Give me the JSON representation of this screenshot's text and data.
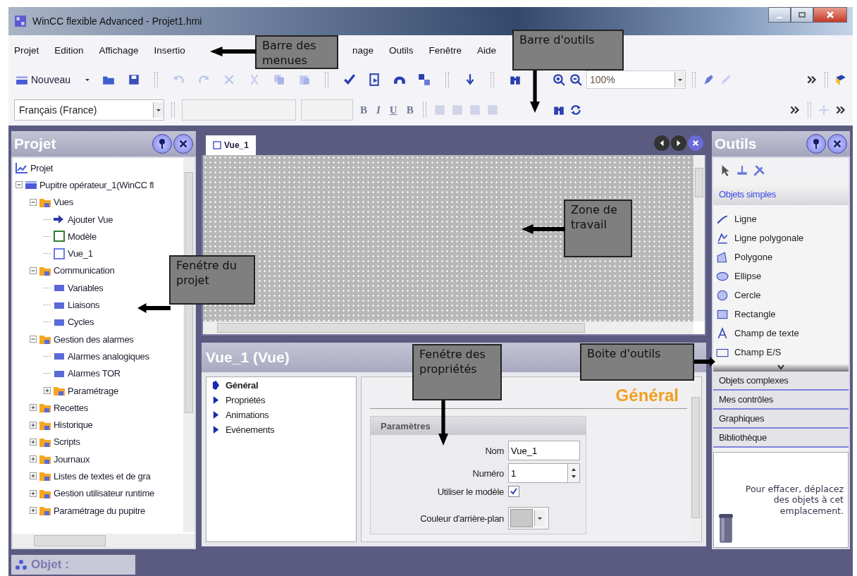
{
  "window": {
    "title": "WinCC flexible Advanced - Projet1.hmi"
  },
  "menu": [
    "Projet",
    "Edition",
    "Affichage",
    "Insertio",
    "nage",
    "Outils",
    "Fenêtre",
    "Aide"
  ],
  "toolbar": {
    "new_label": "Nouveau",
    "zoom": "100%",
    "language": "Français (France)",
    "format_buttons": [
      "B",
      "I",
      "U",
      "B"
    ]
  },
  "project_panel": {
    "title": "Projet",
    "root": "Projet",
    "tree": [
      {
        "label": "Pupitre opérateur_1(WinCC fl",
        "kind": "device",
        "expanded": true,
        "children": [
          {
            "label": "Vues",
            "kind": "folder",
            "expanded": true,
            "children": [
              {
                "label": "Ajouter Vue",
                "kind": "add"
              },
              {
                "label": "Modèle",
                "kind": "template"
              },
              {
                "label": "Vue_1",
                "kind": "screen"
              }
            ]
          },
          {
            "label": "Communication",
            "kind": "folder",
            "expanded": true,
            "children": [
              {
                "label": "Variables",
                "kind": "item"
              },
              {
                "label": "Liaisons",
                "kind": "item"
              },
              {
                "label": "Cycles",
                "kind": "item"
              }
            ]
          },
          {
            "label": "Gestion des alarmes",
            "kind": "folder",
            "expanded": true,
            "children": [
              {
                "label": "Alarmes analogiques",
                "kind": "item"
              },
              {
                "label": "Alarmes TOR",
                "kind": "item"
              },
              {
                "label": "Paramétrage",
                "kind": "folder",
                "expanded": false
              }
            ]
          },
          {
            "label": "Recettes",
            "kind": "folder",
            "expanded": false
          },
          {
            "label": "Historique",
            "kind": "folder",
            "expanded": false
          },
          {
            "label": "Scripts",
            "kind": "folder",
            "expanded": false
          },
          {
            "label": "Journaux",
            "kind": "folder",
            "expanded": false
          },
          {
            "label": "Listes de textes et de gra",
            "kind": "folder",
            "expanded": false
          },
          {
            "label": "Gestion utilisateur runtime",
            "kind": "folder",
            "expanded": false
          },
          {
            "label": "Paramétrage du pupitre",
            "kind": "folder",
            "expanded": false
          }
        ]
      }
    ]
  },
  "editor": {
    "tabs": [
      {
        "label": "Vue_1",
        "selected": true
      }
    ]
  },
  "properties": {
    "title": "Vue_1 (Vue)",
    "heading": "Général",
    "nav": [
      {
        "label": "Général",
        "selected": true
      },
      {
        "label": "Propriétés",
        "selected": false
      },
      {
        "label": "Animations",
        "selected": false
      },
      {
        "label": "Evénements",
        "selected": false
      }
    ],
    "group": "Paramètres",
    "name_label": "Nom",
    "name_value": "Vue_1",
    "number_label": "Numéro",
    "number_value": "1",
    "template_label": "Utiliser le modèle",
    "use_template": true,
    "bg_label": "Couleur d'arrière-plan"
  },
  "tools_panel": {
    "title": "Outils",
    "categories": [
      {
        "label": "Objets simples",
        "selected": true,
        "items": [
          "Ligne",
          "Ligne polygonale",
          "Polygone",
          "Ellipse",
          "Cercle",
          "Rectangle",
          "Champ de texte",
          "Champ E/S"
        ]
      },
      {
        "label": "Objets complexes",
        "selected": false
      },
      {
        "label": "Mes contrôles",
        "selected": false
      },
      {
        "label": "Graphiques",
        "selected": false
      },
      {
        "label": "Bibliothèque",
        "selected": false
      }
    ],
    "trash_hint": "Pour effacer, déplacez des objets à cet emplacement."
  },
  "status_bar": {
    "object_label": "Objet :"
  },
  "callouts": [
    {
      "text": "Barre des menues",
      "kind": "left"
    },
    {
      "text": "Barre d'outils",
      "kind": "down"
    },
    {
      "text": "Zone de travail",
      "kind": "left"
    },
    {
      "text": "Fenétre du projet",
      "kind": "left"
    },
    {
      "text": "Fenétre des propriétés",
      "kind": "down"
    },
    {
      "text": "Boite d'outils",
      "kind": "right"
    }
  ]
}
